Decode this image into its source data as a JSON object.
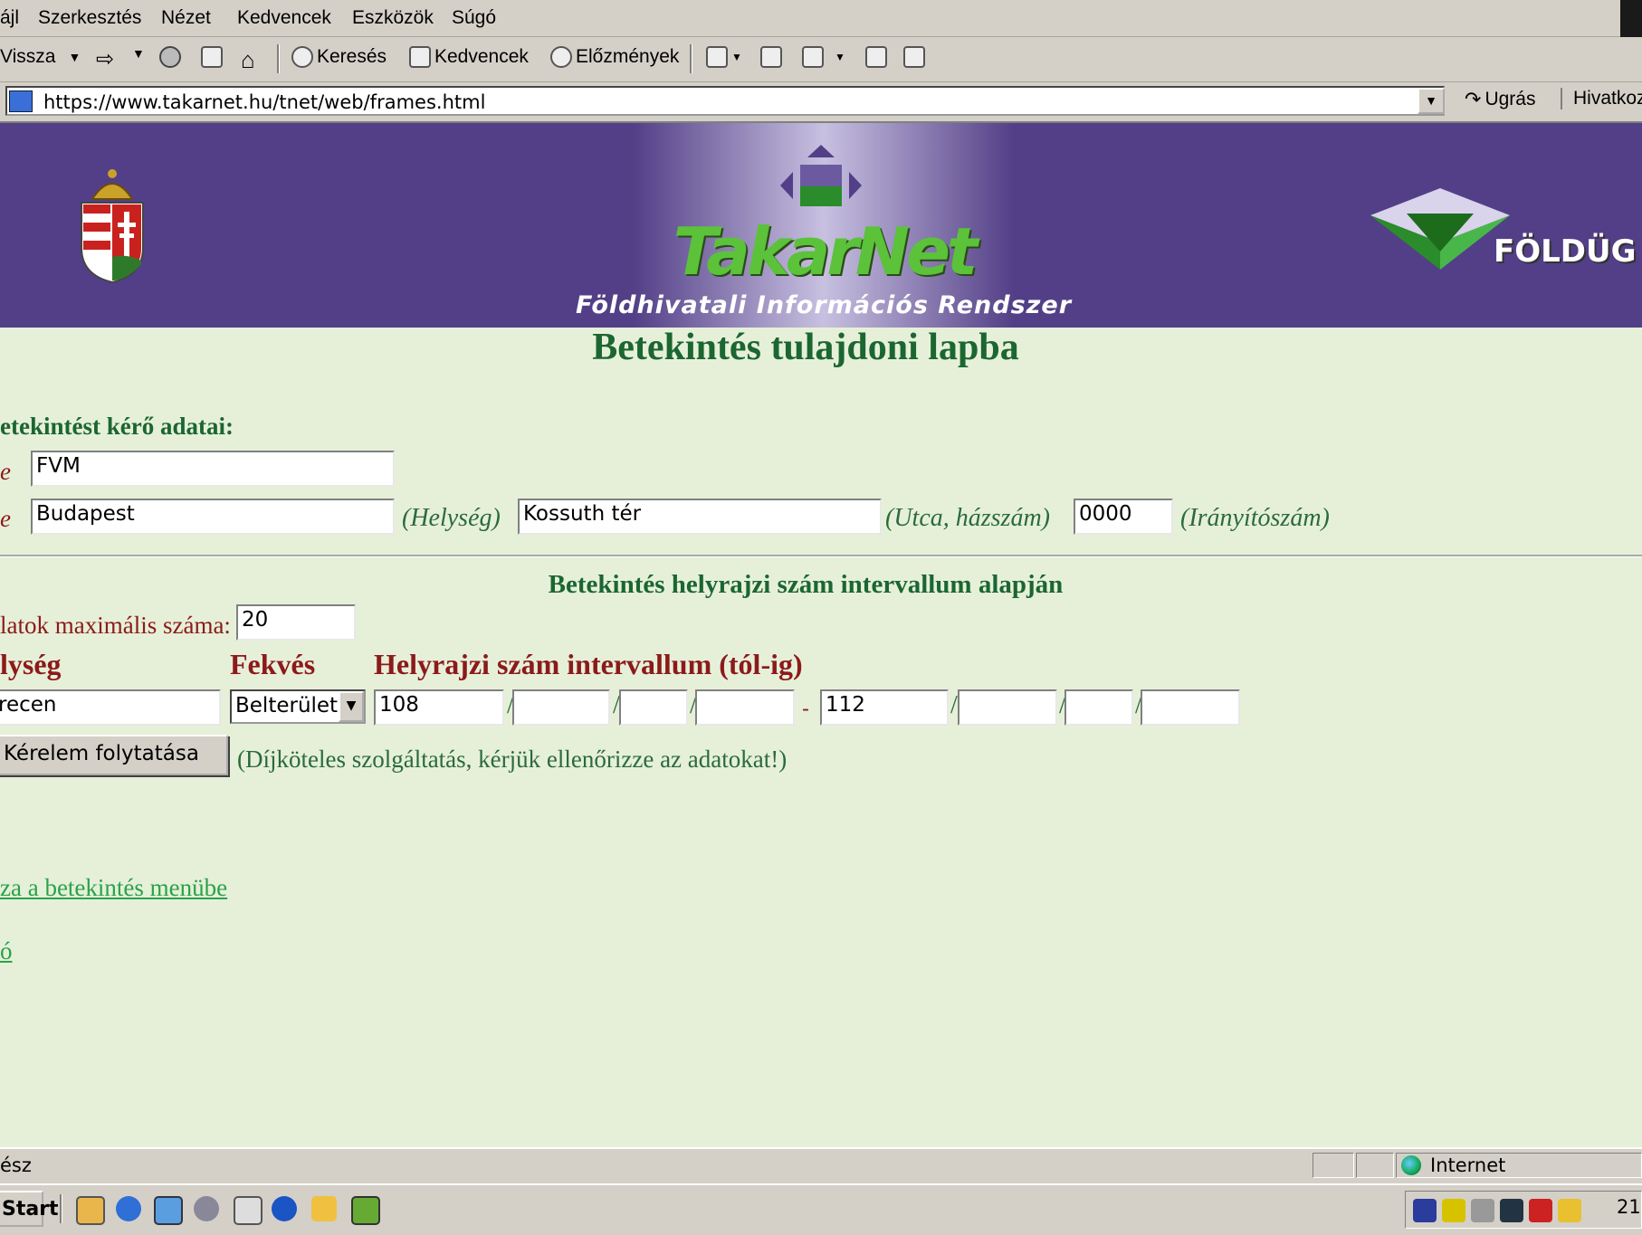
{
  "menu": [
    "ájl",
    "Szerkesztés",
    "Nézet",
    "Kedvencek",
    "Eszközök",
    "Súgó"
  ],
  "toolbar": {
    "back_label": "Vissza",
    "search_label": "Keresés",
    "favorites_label": "Kedvencek",
    "history_label": "Előzmények"
  },
  "address": {
    "url": "https://www.takarnet.hu/tnet/web/frames.html",
    "go_label": "Ugrás",
    "links_label": "Hivatkoz"
  },
  "banner": {
    "brand": "TakarNet",
    "subtitle": "Földhivatali Információs Rendszer",
    "right_text": "FÖLDÜG"
  },
  "page": {
    "title": "Betekintés tulajdoni lapba",
    "requester_heading": "etekintést kérő adatai:",
    "name_label": "e",
    "address_label": "e",
    "name_value": "FVM",
    "city_value": "Budapest",
    "city_hint": "(Helység)",
    "street_value": "Kossuth tér",
    "street_hint": "(Utca, házszám)",
    "zip_value": "0000",
    "zip_hint": "(Irányítószám)",
    "section_title": "Betekintés helyrajzi szám intervallum alapján",
    "max_label": "latok maximális száma:",
    "max_value": "20",
    "col_locality": "lység",
    "col_fekves": "Fekvés",
    "col_interval": "Helyrajzi szám intervallum (tól-ig)",
    "locality_value": "recen",
    "fekves_value": "Belterület",
    "from_values": [
      "108",
      "",
      "",
      ""
    ],
    "to_values": [
      "112",
      "",
      "",
      ""
    ],
    "dash": "-",
    "slash": "/",
    "submit_label": "Kérelem folytatása",
    "submit_note": "(Díjköteles szolgáltatás, kérjük ellenőrizze az adatokat!)",
    "back_link": "za a betekintés menübe",
    "other_link": "ó"
  },
  "statusbar": {
    "status_text": "ész",
    "zone": "Internet"
  },
  "taskbar": {
    "start_label": "Start",
    "clock": "21:"
  }
}
